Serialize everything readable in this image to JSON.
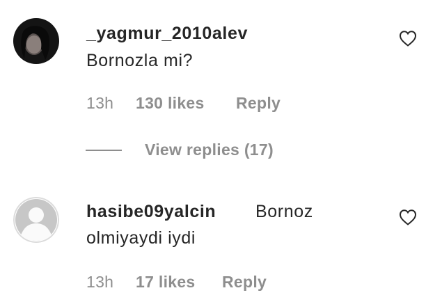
{
  "comments": [
    {
      "username": "_yagmur_2010alev",
      "text": "Bornozla mi?",
      "time": "13h",
      "likes": "130 likes",
      "reply": "Reply",
      "view_replies": "View replies (17)"
    },
    {
      "username": "hasibe09yalcin",
      "text_line1": "Bornoz",
      "text_line2": "olmiyaydi iydi",
      "time": "13h",
      "likes": "17 likes",
      "reply": "Reply"
    }
  ],
  "icons": {
    "like": "heart-outline-icon",
    "default_avatar": "default-avatar-icon"
  },
  "colors": {
    "text": "#262626",
    "secondary": "#8e8e8e",
    "avatar_placeholder": "#c7c7c7"
  }
}
